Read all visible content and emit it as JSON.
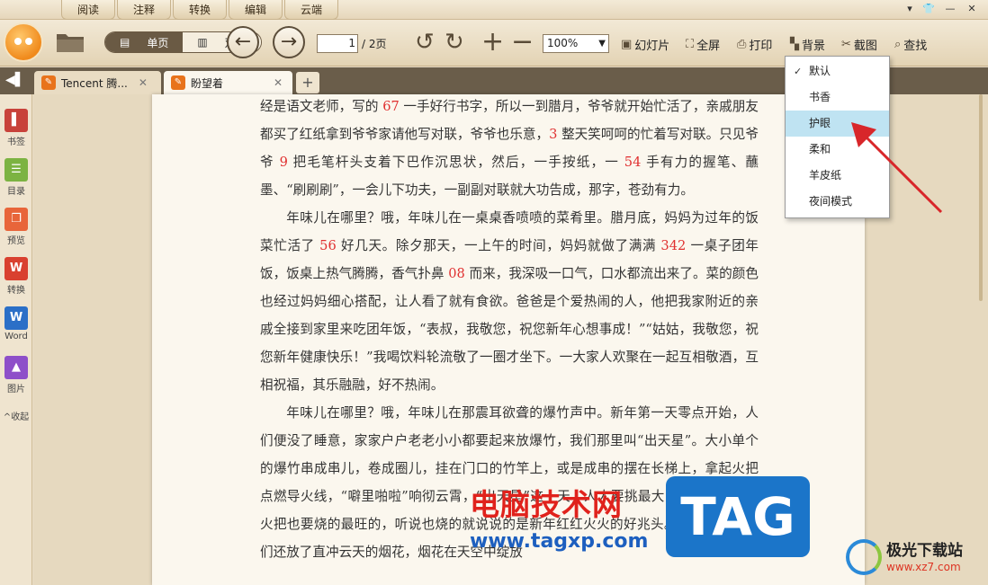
{
  "menubar": {
    "tabs": [
      "阅读",
      "注释",
      "转换",
      "编辑",
      "云端"
    ]
  },
  "window_controls": [
    "▾",
    "👕",
    "—",
    "✕"
  ],
  "toolbar": {
    "single_page": "单页",
    "double_page": "双页",
    "current_page": "1",
    "total_pages": "/ 2页",
    "zoom": "100%",
    "slideshow": "幻灯片",
    "fullscreen": "全屏",
    "print": "打印",
    "background": "背景",
    "screenshot": "截图",
    "search": "查找"
  },
  "doc_tabs": [
    {
      "title": "Tencent 腾...",
      "active": false
    },
    {
      "title": "盼望着",
      "active": true
    }
  ],
  "sidebar": {
    "items": [
      {
        "label": "书签",
        "icon": "bookmark-icon",
        "color": "#c8423a"
      },
      {
        "label": "目录",
        "icon": "toc-icon",
        "color": "#7cb342"
      },
      {
        "label": "预览",
        "icon": "preview-icon",
        "color": "#e8653a"
      },
      {
        "label": "转换",
        "icon": "pdf-convert-icon",
        "color": "#d9402f"
      },
      {
        "label": "Word",
        "icon": "word-icon",
        "color": "#2b6fc7"
      },
      {
        "label": "图片",
        "icon": "image-icon",
        "color": "#8e4fc9"
      }
    ],
    "collapse": "收起"
  },
  "background_menu": {
    "items": [
      {
        "label": "默认",
        "checked": true,
        "highlighted": false
      },
      {
        "label": "书香",
        "checked": false,
        "highlighted": false
      },
      {
        "label": "护眼",
        "checked": false,
        "highlighted": true
      },
      {
        "label": "柔和",
        "checked": false,
        "highlighted": false
      },
      {
        "label": "羊皮纸",
        "checked": false,
        "highlighted": false
      },
      {
        "label": "夜间模式",
        "checked": false,
        "highlighted": false
      }
    ]
  },
  "document": {
    "paragraphs": [
      {
        "indent": false,
        "parts": [
          {
            "t": "经是语文老师，写的 "
          },
          {
            "n": "67"
          },
          {
            "t": " 一手好行书字，所以一到腊月，爷爷就开始忙活了，亲戚朋友都买了红纸拿到爷爷家请他写对联，爷爷也乐意，"
          },
          {
            "n": "3"
          },
          {
            "t": " 整天笑呵呵的忙着写对联。只见爷爷 "
          },
          {
            "n": "9"
          },
          {
            "t": " 把毛笔杆头支着下巴作沉思状，然后，一手按纸，一 "
          },
          {
            "n": "54"
          },
          {
            "t": " 手有力的握笔、蘸墨、“刷刷刷”，一会儿下功夫，一副副对联就大功告成，那字，苍劲有力。"
          }
        ]
      },
      {
        "indent": true,
        "parts": [
          {
            "t": "年味儿在哪里？哦，年味儿在一桌桌香喷喷的菜肴里。腊月底，妈妈为过年的饭菜忙活了 "
          },
          {
            "n": "56"
          },
          {
            "t": " 好几天。除夕那天，一上午的时间，妈妈就做了满满 "
          },
          {
            "n": "342"
          },
          {
            "t": " 一桌子团年饭，饭桌上热气腾腾，香气扑鼻 "
          },
          {
            "n": "08"
          },
          {
            "t": " 而来，我深吸一口气，口水都流出来了。菜的颜色也经过妈妈细心搭配，让人看了就有食欲。爸爸是个爱热闹的人，他把我家附近的亲戚全接到家里来吃团年饭，“表叔，我敬您，祝您新年心想事成！”“姑姑，我敬您，祝您新年健康快乐！”我喝饮料轮流敬了一圈才坐下。一大家人欢聚在一起互相敬酒，互相祝福，其乐融融，好不热闹。"
          }
        ]
      },
      {
        "indent": true,
        "parts": [
          {
            "t": "年味儿在哪里？哦，年味儿在那震耳欲聋的爆竹声中。新年第一天零点开始，人们便没了睡意，家家户户老老小小都要起来放爆竹，我们那里叫“出天星”。大小单个的爆竹串成串儿，卷成圈儿，挂在门口的竹竿上，或是成串的摆在长梯上，拿起火把点燃导火线，“噼里啪啦”响彻云霄，“出天星”这一天，人人要挑最大的、最响的，点火把也要烧的最旺的，听说也烧的就说说的是新年红红火火的好兆头。“出天星”后我们还放了直冲云天的烟花，烟花在天空中绽放"
          }
        ]
      }
    ]
  },
  "watermarks": {
    "site_cn": "电脑技术网",
    "site_url": "www.tagxp.com",
    "tag": "TAG",
    "brand2": "极光下载站",
    "brand2_url": "www.xz7.com"
  }
}
